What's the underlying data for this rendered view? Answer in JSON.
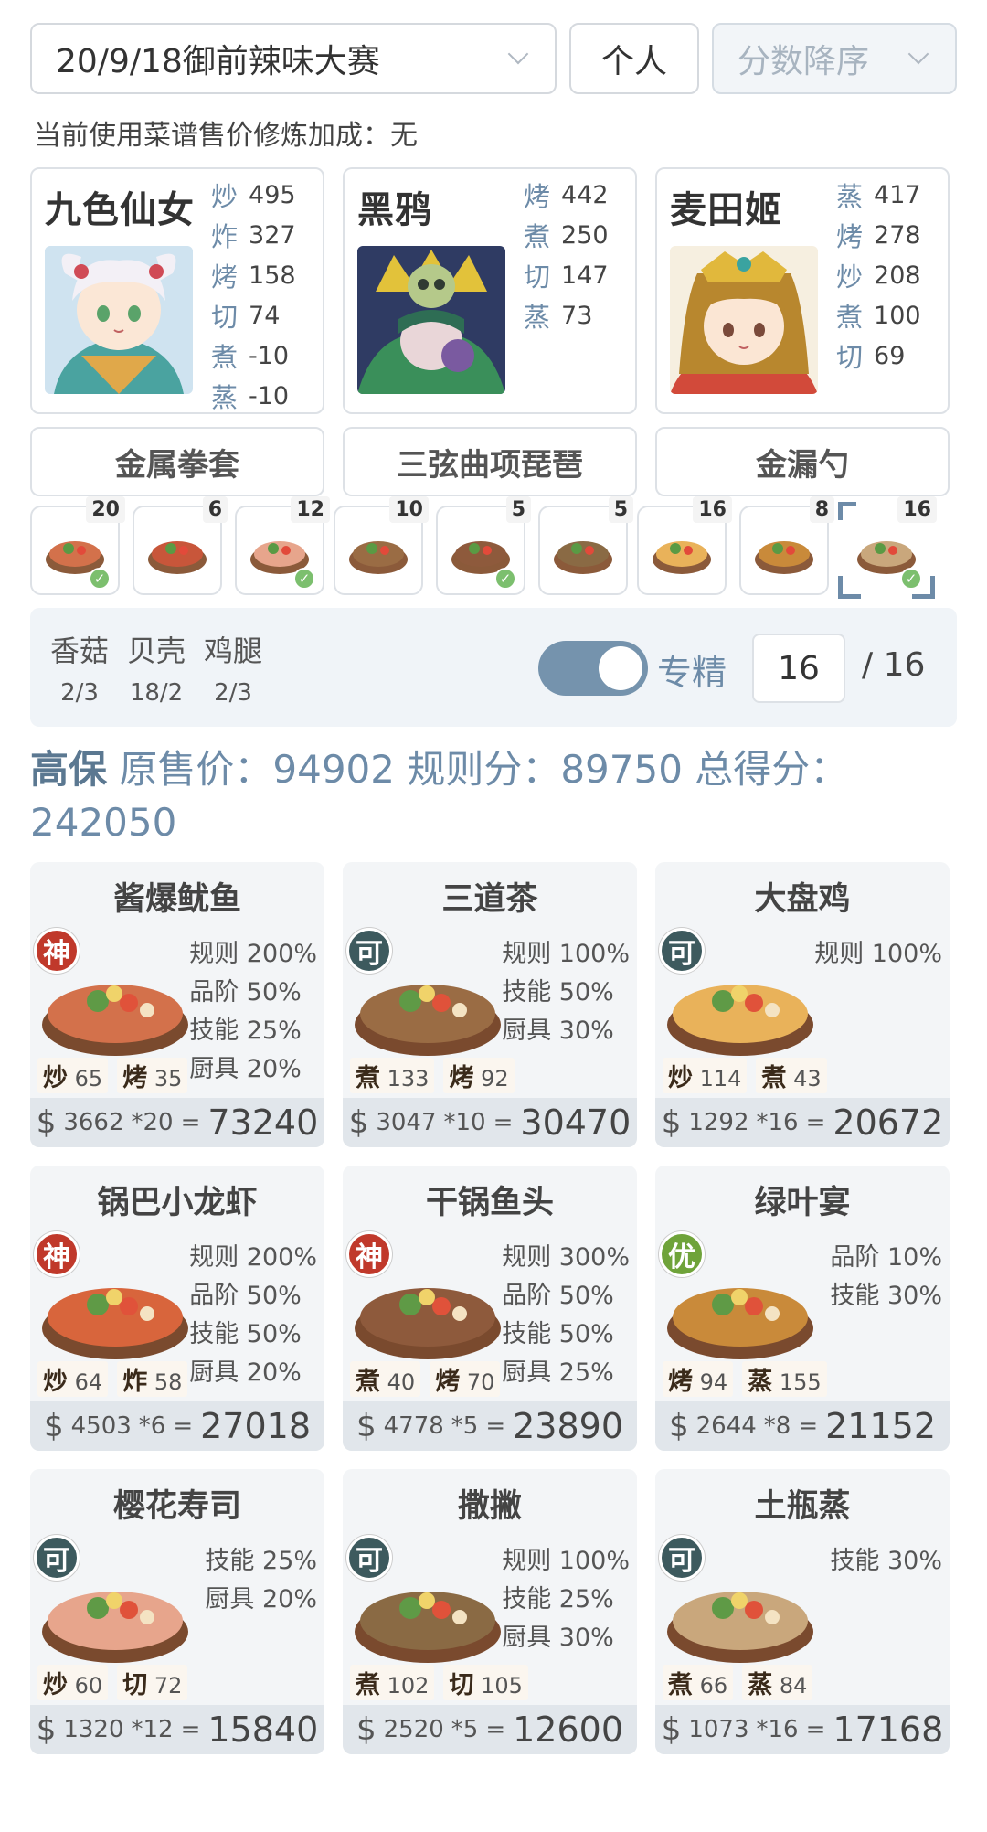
{
  "header": {
    "event": "20/9/18御前辣味大赛",
    "mode": "个人",
    "sort": "分数降序",
    "bonus_text": "当前使用菜谱售价修炼加成：无"
  },
  "chefs": [
    {
      "name": "九色仙女",
      "skills": [
        {
          "k": "炒",
          "v": "495"
        },
        {
          "k": "炸",
          "v": "327"
        },
        {
          "k": "烤",
          "v": "158"
        },
        {
          "k": "切",
          "v": "74"
        },
        {
          "k": "煮",
          "v": "-10"
        },
        {
          "k": "蒸",
          "v": "-10"
        }
      ],
      "equip": "金属拳套"
    },
    {
      "name": "黑鸦",
      "skills": [
        {
          "k": "烤",
          "v": "442"
        },
        {
          "k": "煮",
          "v": "250"
        },
        {
          "k": "切",
          "v": "147"
        },
        {
          "k": "蒸",
          "v": "73"
        }
      ],
      "equip": "三弦曲项琵琶"
    },
    {
      "name": "麦田姬",
      "skills": [
        {
          "k": "蒸",
          "v": "417"
        },
        {
          "k": "烤",
          "v": "278"
        },
        {
          "k": "炒",
          "v": "208"
        },
        {
          "k": "煮",
          "v": "100"
        },
        {
          "k": "切",
          "v": "69"
        }
      ],
      "equip": "金漏勺"
    }
  ],
  "slots": [
    {
      "count": "20",
      "checked": true
    },
    {
      "count": "6",
      "checked": false
    },
    {
      "count": "12",
      "checked": true
    },
    {
      "count": "10",
      "checked": false
    },
    {
      "count": "5",
      "checked": true
    },
    {
      "count": "5",
      "checked": false
    },
    {
      "count": "16",
      "checked": false
    },
    {
      "count": "8",
      "checked": false
    },
    {
      "count": "16",
      "checked": true
    }
  ],
  "ingredients": [
    {
      "name": "香菇",
      "value": "2/3"
    },
    {
      "name": "贝壳",
      "value": "18/2"
    },
    {
      "name": "鸡腿",
      "value": "2/3"
    }
  ],
  "mastery": {
    "label": "专精",
    "value": "16",
    "max": "/ 16"
  },
  "summary": {
    "tag": "高保",
    "text": "原售价：94902 规则分：89750 总得分：242050"
  },
  "dishes": [
    {
      "title": "酱爆鱿鱼",
      "badge": "神",
      "badge_class": "b-shen",
      "s1k": "炒",
      "s1v": "65",
      "s2k": "烤",
      "s2v": "35",
      "buffs": [
        "规则 200%",
        "品阶 50%",
        "技能 25%",
        "厨具 20%"
      ],
      "price": "3662",
      "mult": "*20",
      "total": "73240",
      "color": "#d3714b"
    },
    {
      "title": "三道茶",
      "badge": "可",
      "badge_class": "b-ke",
      "s1k": "煮",
      "s1v": "133",
      "s2k": "烤",
      "s2v": "92",
      "buffs": [
        "规则 100%",
        "技能 50%",
        "厨具 30%"
      ],
      "price": "3047",
      "mult": "*10",
      "total": "30470",
      "color": "#9a6c44"
    },
    {
      "title": "大盘鸡",
      "badge": "可",
      "badge_class": "b-ke",
      "s1k": "炒",
      "s1v": "114",
      "s2k": "煮",
      "s2v": "43",
      "buffs": [
        "规则 100%"
      ],
      "price": "1292",
      "mult": "*16",
      "total": "20672",
      "color": "#e9b25a"
    },
    {
      "title": "锅巴小龙虾",
      "badge": "神",
      "badge_class": "b-shen",
      "s1k": "炒",
      "s1v": "64",
      "s2k": "炸",
      "s2v": "58",
      "buffs": [
        "规则 200%",
        "品阶 50%",
        "技能 50%",
        "厨具 20%"
      ],
      "price": "4503",
      "mult": "*6",
      "total": "27018",
      "color": "#d8653c"
    },
    {
      "title": "干锅鱼头",
      "badge": "神",
      "badge_class": "b-shen",
      "s1k": "煮",
      "s1v": "40",
      "s2k": "烤",
      "s2v": "70",
      "buffs": [
        "规则 300%",
        "品阶 50%",
        "技能 50%",
        "厨具 25%"
      ],
      "price": "4778",
      "mult": "*5",
      "total": "23890",
      "color": "#8e5a3c"
    },
    {
      "title": "绿叶宴",
      "badge": "优",
      "badge_class": "b-you",
      "s1k": "烤",
      "s1v": "94",
      "s2k": "蒸",
      "s2v": "155",
      "buffs": [
        "品阶 10%",
        "技能 30%"
      ],
      "price": "2644",
      "mult": "*8",
      "total": "21152",
      "color": "#c98a3a"
    },
    {
      "title": "樱花寿司",
      "badge": "可",
      "badge_class": "b-ke",
      "s1k": "炒",
      "s1v": "60",
      "s2k": "切",
      "s2v": "72",
      "buffs": [
        "技能 25%",
        "厨具 20%"
      ],
      "price": "1320",
      "mult": "*12",
      "total": "15840",
      "color": "#e7a58c"
    },
    {
      "title": "撒撇",
      "badge": "可",
      "badge_class": "b-ke",
      "s1k": "煮",
      "s1v": "102",
      "s2k": "切",
      "s2v": "105",
      "buffs": [
        "规则 100%",
        "技能 25%",
        "厨具 30%"
      ],
      "price": "2520",
      "mult": "*5",
      "total": "12600",
      "color": "#8a6a44"
    },
    {
      "title": "土瓶蒸",
      "badge": "可",
      "badge_class": "b-ke",
      "s1k": "煮",
      "s1v": "66",
      "s2k": "蒸",
      "s2v": "84",
      "buffs": [
        "技能 30%"
      ],
      "price": "1073",
      "mult": "*16",
      "total": "17168",
      "color": "#c9a77c"
    }
  ]
}
